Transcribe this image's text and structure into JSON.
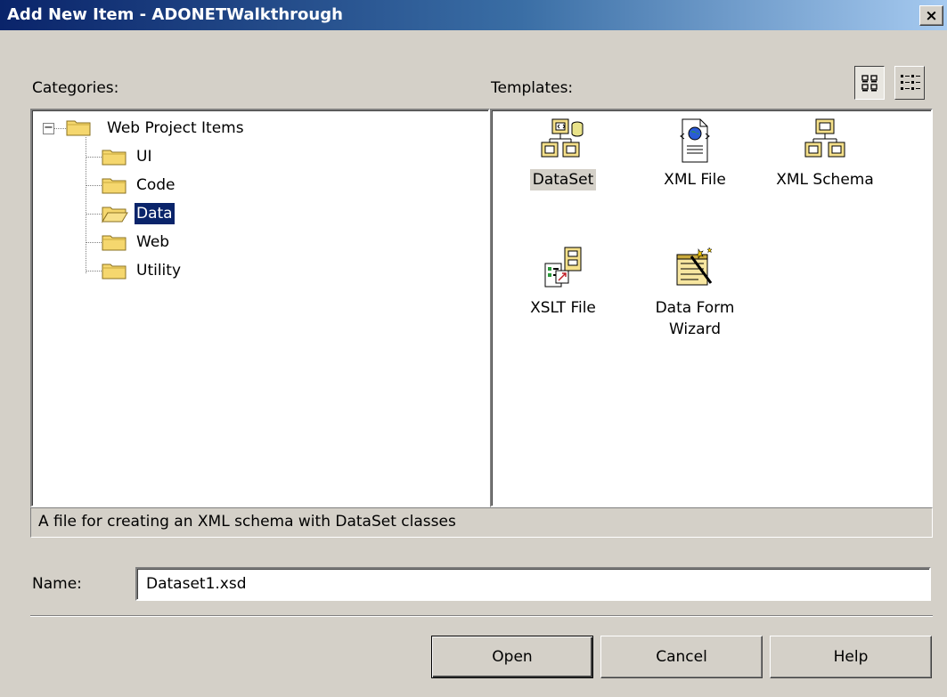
{
  "window": {
    "title": "Add New Item - ADONETWalkthrough",
    "close_label": "×"
  },
  "categories": {
    "label": "Categories:",
    "root": "Web Project Items",
    "items": [
      "UI",
      "Code",
      "Data",
      "Web",
      "Utility"
    ],
    "selected": "Data"
  },
  "templates": {
    "label": "Templates:",
    "items": [
      {
        "label": "DataSet",
        "icon": "dataset-icon",
        "selected": true
      },
      {
        "label": "XML File",
        "icon": "xml-file-icon"
      },
      {
        "label": "XML Schema",
        "icon": "xml-schema-icon"
      },
      {
        "label": "XSLT File",
        "icon": "xslt-file-icon"
      },
      {
        "label_line1": "Data Form",
        "label_line2": "Wizard",
        "icon": "data-form-wizard-icon"
      }
    ],
    "view_buttons": [
      "large-icons-view-icon",
      "list-view-icon"
    ]
  },
  "description": "A file for creating an XML schema with DataSet classes",
  "name_field": {
    "label": "Name:",
    "value": "Dataset1.xsd"
  },
  "buttons": {
    "open": "Open",
    "cancel": "Cancel",
    "help": "Help"
  },
  "colors": {
    "title_bar": "#0a246a",
    "selection": "#0a246a",
    "dialog_face": "#d4d0c8",
    "folder": "#f5d76e"
  }
}
